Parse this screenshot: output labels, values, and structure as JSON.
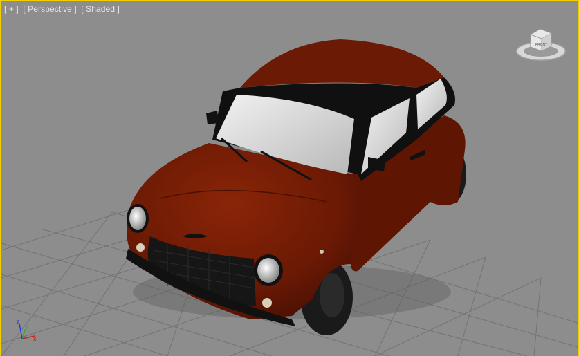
{
  "viewport": {
    "labels": {
      "plus": "[ + ]",
      "view": "[ Perspective ]",
      "shading": "[ Shaded ]"
    },
    "active_border_color": "#f0d000",
    "background_color": "#8d8d8d",
    "grid_color": "#6f6f6f"
  },
  "navcube": {
    "face_label": "FRONT",
    "icon": "viewcube-icon"
  },
  "axis_tripod": {
    "x_label": "x",
    "y_label": "y",
    "z_label": "z",
    "x_color": "#d02020",
    "y_color": "#20b020",
    "z_color": "#2040e0"
  },
  "model": {
    "name": "car-model",
    "body_color": "#6e1a05",
    "glass_color": "#d9d9d9",
    "tire_color": "#1a1a1a"
  }
}
